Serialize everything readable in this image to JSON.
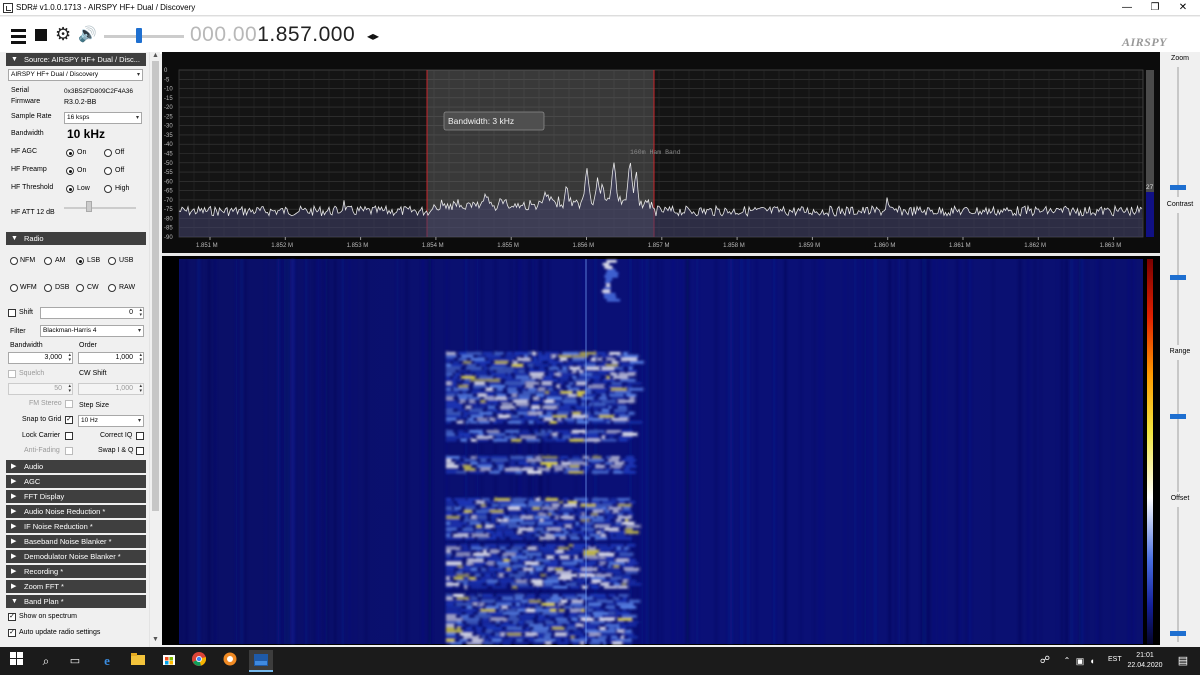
{
  "window": {
    "title": "SDR# v1.0.0.1713 - AIRSPY HF+ Dual / Discovery",
    "minimize": "—",
    "restore": "❐",
    "close": "✕"
  },
  "toolbar": {
    "freq_dim": "000.00",
    "freq_bright": "1.857.000",
    "tune_arrows": "◂▸",
    "logo": "AIRSPY",
    "volume_level": 0.4
  },
  "source": {
    "section_title": "Source: AIRSPY HF+ Dual / Disc...",
    "device": "AIRSPY HF+ Dual / Discovery",
    "serial_label": "Serial",
    "serial": "0x3B52FD809C2F4A36",
    "firmware_label": "Firmware",
    "firmware": "R3.0.2-BB",
    "sample_rate_label": "Sample Rate",
    "sample_rate": "16 ksps",
    "bandwidth_label": "Bandwidth",
    "bandwidth": "10 kHz",
    "hf_agc_label": "HF AGC",
    "hf_preamp_label": "HF Preamp",
    "hf_threshold_label": "HF Threshold",
    "on": "On",
    "off": "Off",
    "low": "Low",
    "high": "High",
    "hf_att_label": "HF ATT 12 dB"
  },
  "radio": {
    "section_title": "Radio",
    "modes_row1": [
      "NFM",
      "AM",
      "LSB",
      "USB"
    ],
    "modes_row2": [
      "WFM",
      "DSB",
      "CW",
      "RAW"
    ],
    "shift_label": "Shift",
    "shift_value": "0",
    "filter_label": "Filter",
    "filter": "Blackman-Harris 4",
    "bandwidth_label": "Bandwidth",
    "order_label": "Order",
    "bandwidth_value": "3,000",
    "order_value": "1,000",
    "squelch_label": "Squelch",
    "cw_shift_label": "CW Shift",
    "squelch_value": "50",
    "cw_shift_value": "1,000",
    "fm_stereo_label": "FM Stereo",
    "step_size_label": "Step Size",
    "snap_label": "Snap to Grid",
    "step_value": "10 Hz",
    "lock_carrier_label": "Lock Carrier",
    "correct_iq_label": "Correct IQ",
    "anti_fading_label": "Anti-Fading",
    "swap_iq_label": "Swap I & Q"
  },
  "plugins": [
    "Audio",
    "AGC",
    "FFT Display",
    "Audio Noise Reduction *",
    "IF Noise Reduction *",
    "Baseband Noise Blanker *",
    "Demodulator Noise Blanker *",
    "Recording *",
    "Zoom FFT *",
    "Band Plan *"
  ],
  "bandplan": {
    "show_on_spectrum": "Show on spectrum",
    "auto_update": "Auto update radio settings"
  },
  "spectrum": {
    "db_ticks": [
      "0",
      "-5",
      "-10",
      "-15",
      "-20",
      "-25",
      "-30",
      "-35",
      "-40",
      "-45",
      "-50",
      "-55",
      "-60",
      "-65",
      "-70",
      "-75",
      "-80",
      "-85",
      "-90"
    ],
    "freq_ticks": [
      "1.851 M",
      "1.852 M",
      "1.853 M",
      "1.854 M",
      "1.855 M",
      "1.856 M",
      "1.857 M",
      "1.858 M",
      "1.859 M",
      "1.860 M",
      "1.861 M",
      "1.862 M",
      "1.863 M"
    ],
    "tooltip": "Bandwidth: 3 kHz",
    "band_label": "160m Ham Band",
    "level_readout": "27"
  },
  "side": {
    "zoom": "Zoom",
    "contrast": "Contrast",
    "range": "Range",
    "offset": "Offset"
  },
  "taskbar": {
    "lang": "EST",
    "time": "21:01",
    "date": "22.04.2020"
  },
  "colors": {
    "section_bg": "#3f3f3f",
    "accent": "#1e6fd0",
    "spectrum_bg": "#0c0c0c",
    "waterfall_bg": "#00003a"
  }
}
